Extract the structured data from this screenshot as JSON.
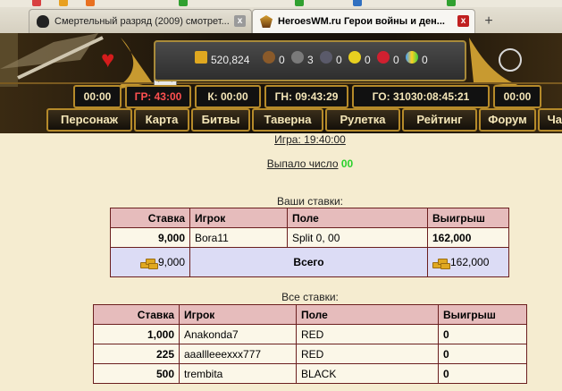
{
  "browser": {
    "tabs": [
      {
        "title": "Смертельный разряд (2009) смотрет...",
        "active": false
      },
      {
        "title": "HeroesWM.ru Герои войны и ден...",
        "active": true
      }
    ],
    "new_tab_glyph": "+",
    "close_glyph": "x"
  },
  "resources": {
    "gold": "520,824",
    "wood": "0",
    "ore": "3",
    "mercury": "0",
    "sulfur": "0",
    "crystals": "0",
    "gems": "0"
  },
  "timers": {
    "t1": "00:00",
    "hp": "ГР: 43:00",
    "k": "К: 00:00",
    "gn": "ГН: 09:43:29",
    "go": "ГО: 31030:08:45:21",
    "t2": "00:00"
  },
  "nav": [
    "Персонаж",
    "Карта",
    "Битвы",
    "Таверна",
    "Рулетка",
    "Рейтинг",
    "Форум",
    "Чат"
  ],
  "game": {
    "time_label": "Игра: 19:40:00",
    "result_label": "Выпало число",
    "result_number": "00"
  },
  "your_bets": {
    "caption": "Ваши ставки:",
    "headers": [
      "Ставка",
      "Игрок",
      "Поле",
      "Выигрыш"
    ],
    "rows": [
      {
        "bet": "9,000",
        "player": "Bora11",
        "field": "Split 0, 00",
        "win": "162,000"
      }
    ],
    "total": {
      "bet": "9,000",
      "label": "Всего",
      "win": "162,000"
    }
  },
  "all_bets": {
    "caption": "Все ставки:",
    "headers": [
      "Ставка",
      "Игрок",
      "Поле",
      "Выигрыш"
    ],
    "rows": [
      {
        "bet": "1,000",
        "player": "Anakonda7",
        "field": "RED",
        "win": "0"
      },
      {
        "bet": "225",
        "player": "aaallleeexxx777",
        "field": "RED",
        "win": "0"
      },
      {
        "bet": "500",
        "player": "trembita",
        "field": "BLACK",
        "win": "0"
      }
    ]
  },
  "colors": {
    "header_border": "#b58a2a",
    "table_header": "#e6bcbc",
    "total_row": "#dcdcf5",
    "result_number": "#2bd12b"
  }
}
